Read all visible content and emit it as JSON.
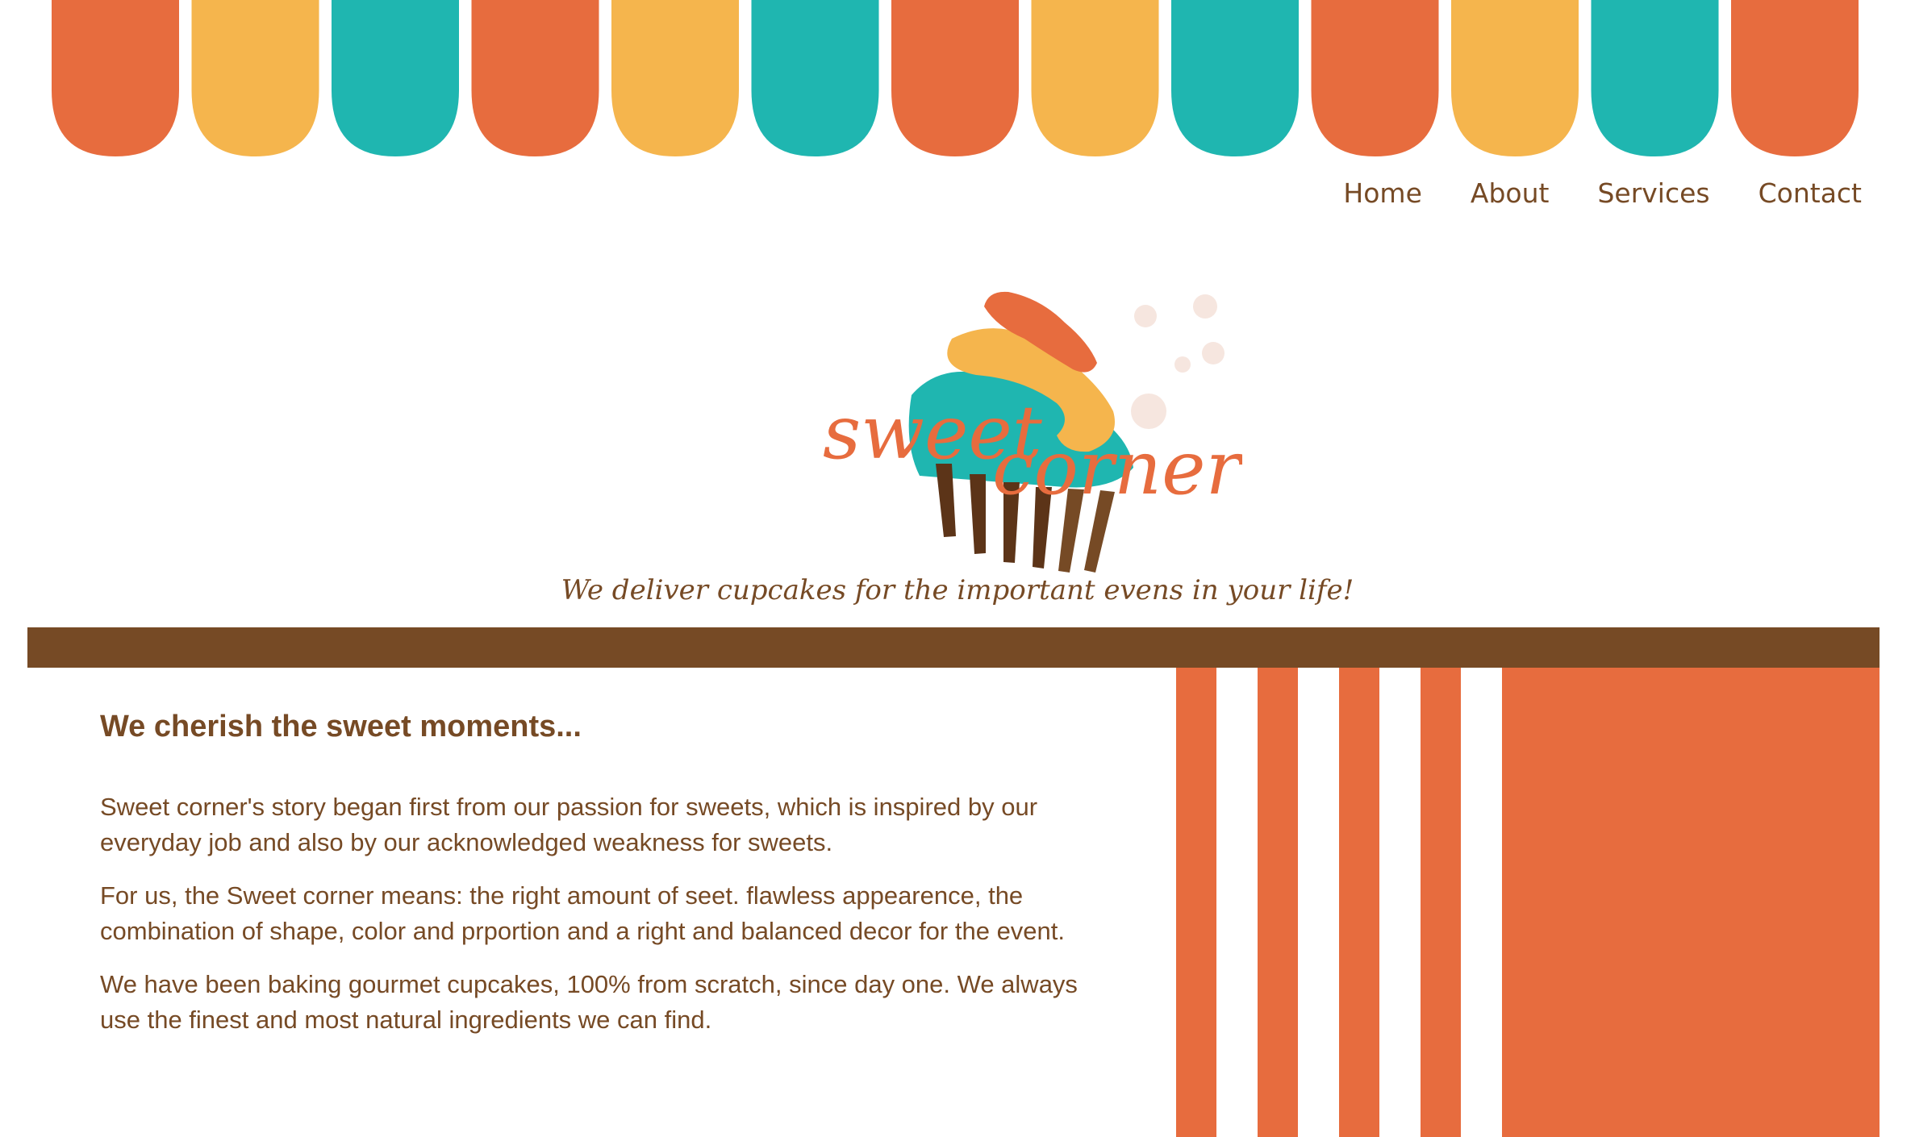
{
  "colors": {
    "orange": "#e76c3e",
    "yellow": "#f5b54d",
    "teal": "#1fb6b0",
    "brown": "#764a25"
  },
  "awning": {
    "scallop_colors": [
      "orange",
      "yellow",
      "teal",
      "orange",
      "yellow",
      "teal",
      "orange",
      "yellow",
      "teal",
      "orange",
      "yellow",
      "teal",
      "orange"
    ]
  },
  "nav": {
    "items": [
      "Home",
      "About",
      "Services",
      "Contact"
    ]
  },
  "logo": {
    "word1": "sweet",
    "word2": "corner",
    "icon": "cupcake-icon"
  },
  "tagline": "We deliver cupcakes for the important evens in your life!",
  "main": {
    "heading": "We cherish the sweet moments...",
    "paragraphs": [
      "Sweet corner's story began first from our passion for sweets, which is inspired by our everyday job and also by our acknowledged weakness for sweets.",
      "For us, the Sweet corner means: the right amount of seet. flawless appearence, the combination of shape, color and prportion and a right and balanced decor for the event.",
      "We have been baking gourmet cupcakes, 100% from scratch, since day one. We always use the finest and most natural ingredients we can find."
    ]
  }
}
